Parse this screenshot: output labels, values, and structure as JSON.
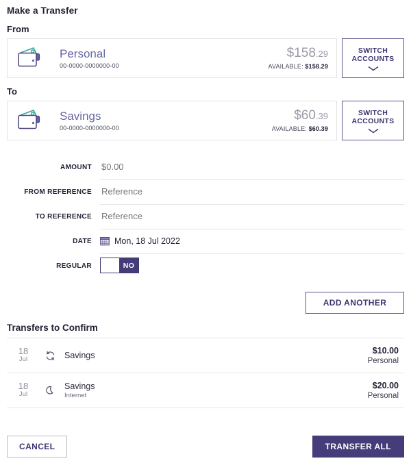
{
  "page": {
    "title": "Make a Transfer"
  },
  "from": {
    "section_label": "From",
    "account": {
      "name": "Personal",
      "number": "00-0000-0000000-00",
      "balance_main": "$158",
      "balance_cents": ".29",
      "available_label": "AVAILABLE:",
      "available_value": "$158.29",
      "icon": "wallet-icon"
    },
    "switch_button": {
      "line1": "SWITCH",
      "line2": "ACCOUNTS",
      "chevron": "chevron-down-icon"
    }
  },
  "to": {
    "section_label": "To",
    "account": {
      "name": "Savings",
      "number": "00-0000-0000000-00",
      "balance_main": "$60",
      "balance_cents": ".39",
      "available_label": "AVAILABLE:",
      "available_value": "$60.39",
      "icon": "wallet-icon"
    },
    "switch_button": {
      "line1": "SWITCH",
      "line2": "ACCOUNTS",
      "chevron": "chevron-down-icon"
    }
  },
  "form": {
    "amount": {
      "label": "AMOUNT",
      "value": "",
      "placeholder": "$0.00"
    },
    "from_reference": {
      "label": "FROM REFERENCE",
      "value": "",
      "placeholder": "Reference"
    },
    "to_reference": {
      "label": "TO REFERENCE",
      "value": "",
      "placeholder": "Reference"
    },
    "date": {
      "label": "DATE",
      "value": "Mon, 18 Jul 2022",
      "icon": "calendar-icon"
    },
    "regular": {
      "label": "REGULAR",
      "toggle_state": "NO"
    }
  },
  "actions": {
    "add_another": "ADD ANOTHER"
  },
  "confirm": {
    "title": "Transfers to Confirm",
    "rows": [
      {
        "day": "18",
        "month": "Jul",
        "icon": "recurring-icon",
        "name": "Savings",
        "sub": "",
        "amount": "$10.00",
        "account": "Personal"
      },
      {
        "day": "18",
        "month": "Jul",
        "icon": "moon-icon",
        "name": "Savings",
        "sub": "Internet",
        "amount": "$20.00",
        "account": "Personal"
      }
    ]
  },
  "footer": {
    "cancel": "CANCEL",
    "transfer_all": "TRANSFER ALL"
  },
  "colors": {
    "primary": "#453c7a",
    "primary_border": "#5a4e8e",
    "accent_teal": "#2fa79b",
    "muted": "#9a9aa8",
    "divider": "#e6e6ea"
  }
}
